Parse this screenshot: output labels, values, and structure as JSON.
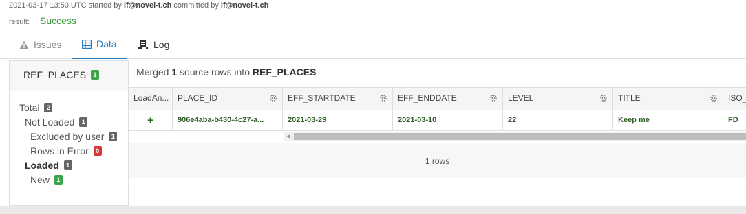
{
  "meta": {
    "timestamp": "2021-03-17 13:50 UTC",
    "started_by_label": "started by",
    "started_by": "lf@novel-t.ch",
    "committed_by_label": "committed by",
    "committed_by": "lf@novel-t.ch"
  },
  "result": {
    "label": "result:",
    "value": "Success"
  },
  "tabs": [
    {
      "label": "Issues",
      "icon": "warning-icon"
    },
    {
      "label": "Data",
      "icon": "table-icon"
    },
    {
      "label": "Log",
      "icon": "scroll-icon"
    }
  ],
  "sidebar": {
    "title": "REF_PLACES",
    "title_badge": "1",
    "items": [
      {
        "label": "Total",
        "badge": "2"
      },
      {
        "label": "Not Loaded",
        "badge": "1"
      },
      {
        "label": "Excluded by user",
        "badge": "1"
      },
      {
        "label": "Rows in Error",
        "badge": "0"
      },
      {
        "label": "Loaded",
        "badge": "1"
      },
      {
        "label": "New",
        "badge": "1"
      }
    ]
  },
  "main": {
    "summary_prefix": "Merged",
    "summary_count": "1",
    "summary_mid": "source rows into",
    "summary_table": "REF_PLACES"
  },
  "grid": {
    "columns": [
      "LoadAn...",
      "PLACE_ID",
      "EFF_STARTDATE",
      "EFF_ENDDATE",
      "LEVEL",
      "TITLE",
      "ISO_"
    ],
    "row": [
      "+",
      "906e4aba-b430-4c27-a...",
      "2021-03-29",
      "2021-03-10",
      "22",
      "Keep me",
      "FD"
    ],
    "footer": "1 rows"
  },
  "colors": {
    "accent": "#2a7ac0",
    "success": "#3a9a3a",
    "data_text": "#2d5d24"
  }
}
